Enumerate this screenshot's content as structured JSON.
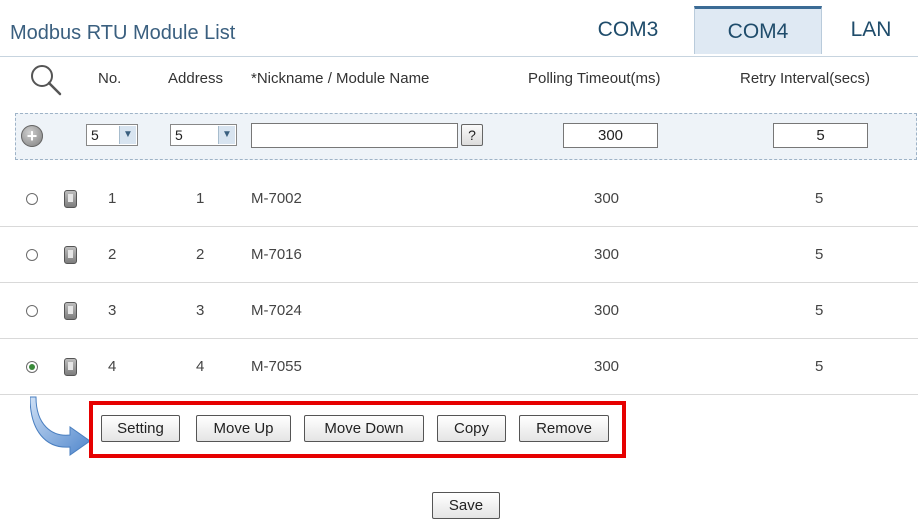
{
  "header": {
    "title": "Modbus RTU Module List",
    "tabs": [
      {
        "label": "COM3",
        "active": false
      },
      {
        "label": "COM4",
        "active": true
      },
      {
        "label": "LAN",
        "active": false
      }
    ]
  },
  "columns": {
    "no": "No.",
    "address": "Address",
    "nickname": "*Nickname / Module Name",
    "polling_timeout": "Polling Timeout(ms)",
    "retry_interval": "Retry Interval(secs)"
  },
  "add_row": {
    "no_selected": "5",
    "address_selected": "5",
    "nickname_value": "",
    "help_label": "?",
    "polling_timeout_value": "300",
    "retry_interval_value": "5"
  },
  "modules": [
    {
      "no": "1",
      "address": "1",
      "name": "M-7002",
      "polling_timeout": "300",
      "retry_interval": "5",
      "selected": false
    },
    {
      "no": "2",
      "address": "2",
      "name": "M-7016",
      "polling_timeout": "300",
      "retry_interval": "5",
      "selected": false
    },
    {
      "no": "3",
      "address": "3",
      "name": "M-7024",
      "polling_timeout": "300",
      "retry_interval": "5",
      "selected": false
    },
    {
      "no": "4",
      "address": "4",
      "name": "M-7055",
      "polling_timeout": "300",
      "retry_interval": "5",
      "selected": true
    }
  ],
  "actions": {
    "setting": "Setting",
    "move_up": "Move Up",
    "move_down": "Move Down",
    "copy": "Copy",
    "remove": "Remove"
  },
  "save_label": "Save",
  "colors": {
    "title": "#3a5f7f",
    "active_tab": "#dfe9f3",
    "highlight_box": "#e60000",
    "arrow": "#5b8fd0"
  },
  "icons": {
    "search": "search-icon",
    "add": "plus-icon",
    "module": "module-icon",
    "arrow": "curved-arrow-icon"
  }
}
